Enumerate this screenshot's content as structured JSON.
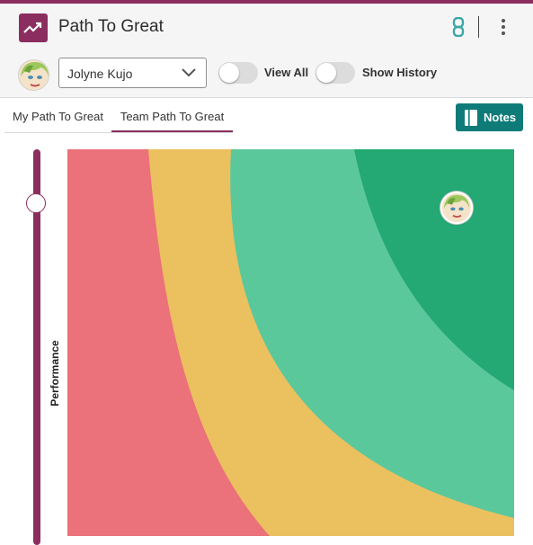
{
  "app": {
    "title": "Path To Great"
  },
  "header": {
    "user_select": {
      "value": "Jolyne Kujo"
    },
    "toggles": [
      {
        "label": "View All",
        "on": false
      },
      {
        "label": "Show History",
        "on": false
      }
    ],
    "icons": [
      "trend-up-icon",
      "link-icon",
      "more-vertical-icon",
      "chevron-down-icon"
    ]
  },
  "tabs": [
    {
      "label": "My Path To Great",
      "active": false
    },
    {
      "label": "Team Path To Great",
      "active": true
    }
  ],
  "notes_button": {
    "label": "Notes"
  },
  "chart": {
    "axis_label": "Performance",
    "zones": [
      {
        "color": "#eb717a"
      },
      {
        "color": "#ebc05f"
      },
      {
        "color": "#5bc89c"
      },
      {
        "color": "#24a874"
      }
    ],
    "avatar": "user-avatar"
  },
  "colors": {
    "brand": "#8b2e5f",
    "notes": "#0f7b78",
    "link_icon": "#39a7a8"
  }
}
